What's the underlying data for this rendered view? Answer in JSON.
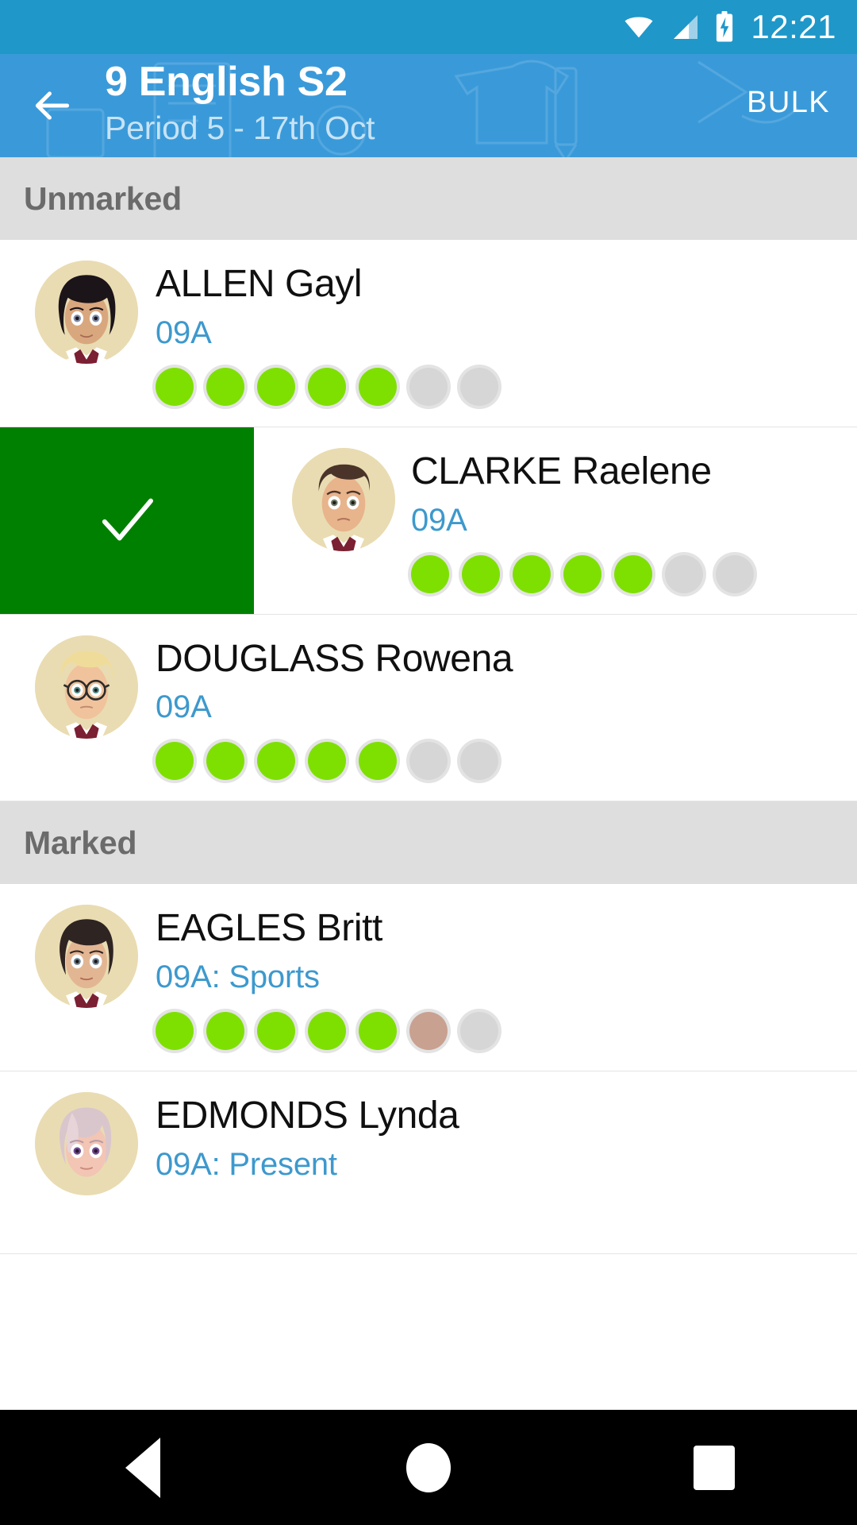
{
  "status_bar": {
    "time": "12:21",
    "icons": [
      "wifi-icon",
      "cellular-signal-icon",
      "battery-charging-icon"
    ]
  },
  "app_bar": {
    "back_icon": "arrow-back-icon",
    "title": "9 English S2",
    "subtitle": "Period 5 - 17th Oct",
    "bulk_label": "BULK",
    "background_color": "#3a9ad9"
  },
  "colors": {
    "status_bar": "#1f97c9",
    "app_bar": "#3a9ad9",
    "accent_blue": "#3d99cd",
    "section_bg": "#dedede",
    "dot_green": "#7ee000",
    "dot_grey": "#d6d6d6",
    "dot_tan": "#c9a191",
    "swipe_green": "#008000"
  },
  "sections": [
    {
      "id": "unmarked",
      "label": "Unmarked",
      "students": [
        {
          "name": "ALLEN Gayl",
          "subinfo": "09A",
          "avatar": "avatar-dark-hair-female",
          "swiped": false,
          "dots": [
            "green",
            "green",
            "green",
            "green",
            "green",
            "grey",
            "grey"
          ]
        },
        {
          "name": "CLARKE Raelene",
          "subinfo": "09A",
          "avatar": "avatar-short-brown-hair-male",
          "swiped": true,
          "swipe_action_icon": "check-icon",
          "dots": [
            "green",
            "green",
            "green",
            "green",
            "green",
            "grey",
            "grey"
          ]
        },
        {
          "name": "DOUGLASS Rowena",
          "subinfo": "09A",
          "avatar": "avatar-blonde-glasses",
          "swiped": false,
          "dots": [
            "green",
            "green",
            "green",
            "green",
            "green",
            "grey",
            "grey"
          ]
        }
      ]
    },
    {
      "id": "marked",
      "label": "Marked",
      "students": [
        {
          "name": "EAGLES Britt",
          "subinfo": "09A: Sports",
          "avatar": "avatar-dark-bob-female",
          "swiped": false,
          "dots": [
            "green",
            "green",
            "green",
            "green",
            "green",
            "tan",
            "grey"
          ]
        },
        {
          "name": "EDMONDS Lynda",
          "subinfo": "09A: Present",
          "avatar": "avatar-pink-hair-female",
          "swiped": false,
          "dots": []
        }
      ]
    }
  ],
  "nav_bar": {
    "back_label": "back-triangle-icon",
    "home_label": "home-circle-icon",
    "recents_label": "recents-square-icon"
  }
}
